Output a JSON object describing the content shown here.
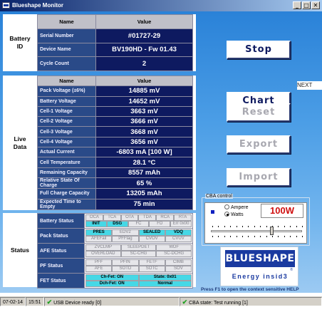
{
  "window": {
    "title": "Blueshape Monitor",
    "controls": [
      "_",
      "□",
      "✕"
    ]
  },
  "battery_id": {
    "label_line1": "Battery",
    "label_line2": "ID",
    "col_name": "Name",
    "col_value": "Value",
    "rows": [
      {
        "name": "Serial Number",
        "value": "#01727-29"
      },
      {
        "name": "Device Name",
        "value": "BV190HD - Fw 01.43"
      },
      {
        "name": "Cycle Count",
        "value": "2"
      }
    ]
  },
  "live_data": {
    "label_line1": "Live",
    "label_line2": "Data",
    "col_name": "Name",
    "col_value": "Value",
    "rows": [
      {
        "name": "Pack Voltage (±6%)",
        "value": "14885 mV"
      },
      {
        "name": "Battery Voltage",
        "value": "14652 mV"
      },
      {
        "name": "Cell-1 Voltage",
        "value": "3663 mV"
      },
      {
        "name": "Cell-2 Voltage",
        "value": "3666 mV"
      },
      {
        "name": "Cell-3 Voltage",
        "value": "3668 mV"
      },
      {
        "name": "Cell-4 Voltage",
        "value": "3656 mV"
      },
      {
        "name": "Actual Current",
        "value": "-6803 mA  [100 W]"
      },
      {
        "name": "Cell Temperature",
        "value": "28.1 °C"
      },
      {
        "name": "Remaining Capacity",
        "value": "8557 mAh"
      },
      {
        "name": "Relative State Of Charge",
        "value": "65 %"
      },
      {
        "name": "Full Charge Capacity",
        "value": "13205 mAh"
      },
      {
        "name": "Expected Time to Empty",
        "value": "75 min"
      }
    ]
  },
  "status": {
    "label": "Status",
    "battery_status": {
      "name": "Battery Status",
      "flags": [
        {
          "t": "OCA",
          "on": false
        },
        {
          "t": "TCA",
          "on": false
        },
        {
          "t": "OTA",
          "on": false
        },
        {
          "t": "TDA",
          "on": false
        },
        {
          "t": "RCA",
          "on": false
        },
        {
          "t": "RTA",
          "on": false
        },
        {
          "t": "INIT",
          "on": true
        },
        {
          "t": "DSG",
          "on": true
        },
        {
          "t": "FC",
          "on": false
        },
        {
          "t": "FD",
          "on": false
        },
        {
          "t": "Err 0x00",
          "on": false
        }
      ]
    },
    "pack_status": {
      "name": "Pack Status",
      "flags": [
        {
          "t": "PRES",
          "on": true
        },
        {
          "t": "EDV2",
          "on": false
        },
        {
          "t": "SEALED",
          "on": true
        },
        {
          "t": "VDQ",
          "on": true
        },
        {
          "t": "AFEFail",
          "on": false
        },
        {
          "t": "PFFlag",
          "on": false
        },
        {
          "t": "CVOV",
          "on": false
        },
        {
          "t": "CVUV",
          "on": false
        }
      ]
    },
    "afe_status": {
      "name": "AFE Status",
      "flags": [
        {
          "t": "ZVCLMP",
          "on": false
        },
        {
          "t": "SLEEPDET",
          "on": false
        },
        {
          "t": "WDF",
          "on": false
        },
        {
          "t": "OVERLOAD",
          "on": false
        },
        {
          "t": "SC-CHG",
          "on": false
        },
        {
          "t": "SC-DCHG",
          "on": false
        }
      ]
    },
    "pf_status": {
      "name": "PF Status",
      "flags": [
        {
          "t": "PFF",
          "on": false
        },
        {
          "t": "PFIN",
          "on": false
        },
        {
          "t": "FETF",
          "on": false
        },
        {
          "t": "CIMB",
          "on": false
        },
        {
          "t": "AFE",
          "on": false
        },
        {
          "t": "SOTD",
          "on": false
        },
        {
          "t": "SOTC",
          "on": false
        },
        {
          "t": "SOV",
          "on": false
        }
      ]
    },
    "fet_status": {
      "name": "FET Status",
      "flags": [
        {
          "t": "Ch-Fet: ON",
          "on": true
        },
        {
          "t": "State: 0x01",
          "on": true
        },
        {
          "t": "Dch-Fet: ON",
          "on": true
        },
        {
          "t": "Normal",
          "on": true
        }
      ]
    }
  },
  "buttons": {
    "stop": "Stop",
    "chart": "Chart",
    "reset": "Reset",
    "export": "Export",
    "import": "Import"
  },
  "tooltip_next": "NEXT",
  "cba": {
    "caption": "CBA control",
    "option_ampere": "Ampere",
    "option_watts": "Watts",
    "selected": "Watts",
    "readout": "100W"
  },
  "logo": {
    "line1": "BLUESHAPE",
    "line2": "Energy insid3",
    "reg": "®"
  },
  "hint": "Press F1 to open the context sensitive HELP",
  "statusbar": {
    "date": "07-02-14",
    "time": "15:51",
    "usb": "USB Device ready [0]",
    "cba_state": "CBA state: Test running [1]"
  }
}
